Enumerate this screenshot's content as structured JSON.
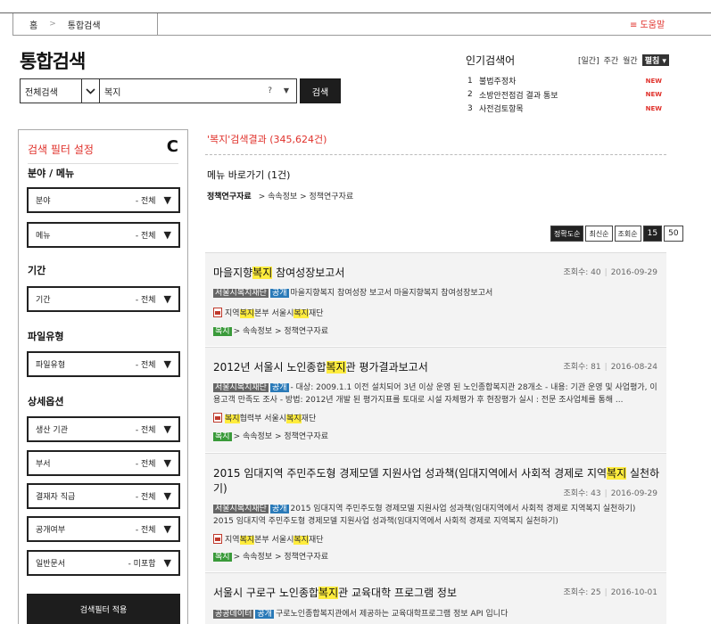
{
  "breadcrumb": {
    "home": "홈",
    "separator": ">",
    "current": "통합검색"
  },
  "help_label": "≡ 도움말",
  "page_title": "통합검색",
  "search": {
    "scope": "전체검색",
    "query": "복지",
    "help_glyph": "?",
    "dropdown_glyph": "▼",
    "button": "검색"
  },
  "popular": {
    "title": "인기검색어",
    "periods": [
      "[일간]",
      "주간",
      "월간"
    ],
    "selected_period": "펼침 ▾",
    "items": [
      {
        "rank": "1",
        "text": "불법주정차",
        "badge": "NEW"
      },
      {
        "rank": "2",
        "text": "소방안전점검 결과 통보",
        "badge": "NEW"
      },
      {
        "rank": "3",
        "text": "사전검토항목",
        "badge": "NEW"
      }
    ]
  },
  "filter": {
    "title": "검색 필터 설정",
    "refresh_glyph": "C",
    "sections": {
      "field_menu": "분야 / 메뉴",
      "period": "기간",
      "file_type": "파일유형",
      "detail": "상세옵션"
    },
    "dropdowns": [
      {
        "label": "분야",
        "value": "- 전체",
        "arrow": "▼"
      },
      {
        "label": "메뉴",
        "value": "- 전체",
        "arrow": "▼"
      },
      {
        "label": "기간",
        "value": "- 전체",
        "arrow": "▼"
      },
      {
        "label": "파일유형",
        "value": "- 전체",
        "arrow": "▼"
      },
      {
        "label": "생산 기관",
        "value": "- 전체",
        "arrow": "▼"
      },
      {
        "label": "부서",
        "value": "- 전체",
        "arrow": "▼"
      },
      {
        "label": "결재자 직급",
        "value": "- 전체",
        "arrow": "▼"
      },
      {
        "label": "공개여부",
        "value": "- 전체",
        "arrow": "▼"
      },
      {
        "label": "일반문서",
        "value": "- 미포함",
        "arrow": "▼"
      }
    ],
    "apply": "검색필터 적용"
  },
  "results": {
    "summary": "'복지'검색결과 (345,624건)",
    "menu_heading": "메뉴 바로가기 (1건)",
    "menu_path": {
      "main": "정책연구자료",
      "sub": "> 속속정보 > 정책연구자료"
    },
    "sort": {
      "options": [
        "정확도순",
        "최신순",
        "조회순"
      ],
      "active": "정확도순",
      "page_sizes": [
        "15",
        "50"
      ],
      "active_size": "15"
    },
    "items": [
      {
        "title_pre": "마을지향",
        "title_hl": "복지",
        "title_post": " 참여성장보고서",
        "views": "조회수: 40",
        "date": "2016-09-29",
        "source": "서울시복지재단",
        "open": "공개",
        "summary": "마을지향복지 참여성장 보고서 마을지향복지 참여성장보고서",
        "file_pre": "지역",
        "file_hl": "복지",
        "file_mid": "본부 서울시",
        "file_hl2": "복지",
        "file_post": "재단",
        "path_tag": "복지",
        "path": "> 속속정보 > 정책연구자료"
      },
      {
        "title_pre": "2012년 서울시 노인종합",
        "title_hl": "복지",
        "title_post": "관 평가결과보고서",
        "views": "조회수: 81",
        "date": "2016-08-24",
        "source": "서울시복지재단",
        "open": "공개",
        "summary": "- 대상: 2009.1.1 이전 설치되어 3년 이상 운영 된 노인종합복지관 28개소 - 내용: 기관 운영 및 사업평가, 이용고객 만족도 조사 - 방법: 2012년 개발 된 평가지표를 토대로 시설 자체평가 후 현장평가 실시 : 전문 조사업체를 통해 ...",
        "file_pre": "",
        "file_hl": "복지",
        "file_mid": "협력부 서울시",
        "file_hl2": "복지",
        "file_post": "재단",
        "path_tag": "복지",
        "path": "> 속속정보 > 정책연구자료"
      },
      {
        "title_pre": "2015 임대지역 주민주도형 경제모델 지원사업 성과책(임대지역에서 사회적 경제로 지역",
        "title_hl": "복지",
        "title_post": " 실천하기)",
        "views": "조회수: 43",
        "date": "2016-09-29",
        "source": "서울시복지재단",
        "open": "공개",
        "summary": "2015 임대지역 주민주도형 경제모델 지원사업 성과책(임대지역에서 사회적 경제로 지역복지 실천하기) 2015 임대지역 주민주도형 경제모델 지원사업 성과책(임대지역에서 사회적 경제로 지역복지 실천하기)",
        "file_pre": "지역",
        "file_hl": "복지",
        "file_mid": "본부 서울시",
        "file_hl2": "복지",
        "file_post": "재단",
        "path_tag": "복지",
        "path": "> 속속정보 > 정책연구자료"
      },
      {
        "title_pre": "서울시 구로구 노인종합",
        "title_hl": "복지",
        "title_post": "관 교육대학 프로그램 정보",
        "views": "조회수: 25",
        "date": "2016-10-01",
        "source": "공공데이터",
        "open": "공개",
        "summary": "구로노인종합복지관에서 제공하는 교육대학프로그램 정보 API 입니다"
      }
    ]
  }
}
